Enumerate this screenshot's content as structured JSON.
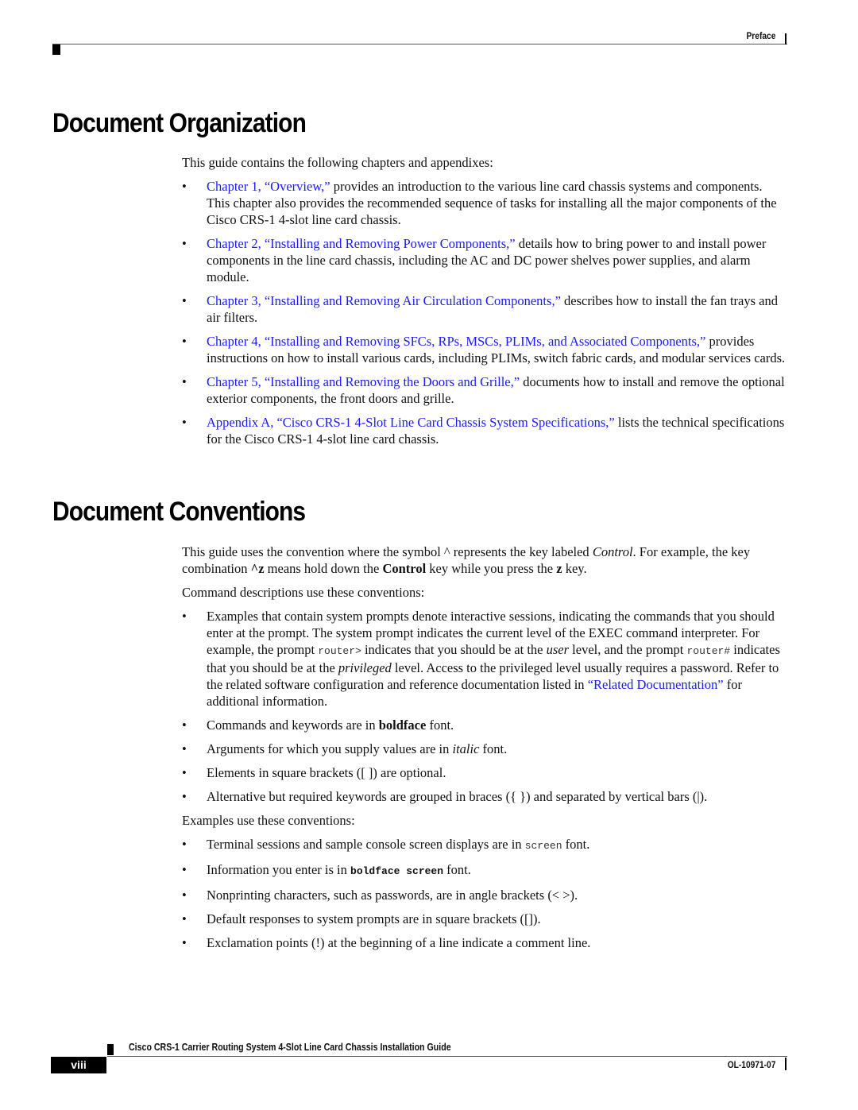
{
  "header": {
    "section": "Preface"
  },
  "organization": {
    "title": "Document Organization",
    "intro": "This guide contains the following chapters and appendixes:",
    "items": [
      {
        "link": "Chapter 1, “Overview,”",
        "text": " provides an introduction to the various line card chassis systems and components. This chapter also provides the recommended sequence of tasks for installing all the major components of the Cisco CRS-1 4-slot line card chassis."
      },
      {
        "link": "Chapter 2, “Installing and Removing Power Components,”",
        "text": " details how to bring power to and install power components in the line card chassis, including the AC and DC power shelves power supplies, and alarm module."
      },
      {
        "link": "Chapter 3, “Installing and Removing Air Circulation Components,”",
        "text": " describes how to install the fan trays and air filters."
      },
      {
        "link": "Chapter 4, “Installing and Removing SFCs, RPs, MSCs, PLIMs, and Associated Components,”",
        "text": " provides instructions on how to install various cards, including PLIMs, switch fabric cards, and modular services cards."
      },
      {
        "link": "Chapter 5, “Installing and Removing the Doors and Grille,”",
        "text": " documents how to install and remove the optional exterior components, the front doors and grille."
      },
      {
        "link": "Appendix A, “Cisco CRS-1 4-Slot Line Card Chassis System Specifications,”",
        "text": " lists the technical specifications for the Cisco CRS-1 4-slot line card chassis."
      }
    ]
  },
  "conventions": {
    "title": "Document Conventions",
    "p1": {
      "a": "This guide uses the convention where the symbol ^ represents the key labeled ",
      "control_italic": "Control",
      "b": ". For example, the key combination ",
      "caret_z": "^z",
      "c": " means hold down the ",
      "control_bold": "Control",
      "d": " key while you press the ",
      "z": "z",
      "e": " key."
    },
    "command_intro": "Command descriptions use these conventions:",
    "command_items": {
      "i0": {
        "a": "Examples that contain system prompts denote interactive sessions, indicating the commands that you should enter at the prompt. The system prompt indicates the current level of the EXEC command interpreter. For example, the prompt ",
        "prompt1": "router>",
        "b": " indicates that you should be at the ",
        "user": "user",
        "c": " level, and the prompt ",
        "prompt2": "router#",
        "d": " indicates that you should be at the ",
        "privileged": "privileged",
        "e": " level. Access to the privileged level usually requires a password. Refer to the related software configuration and reference documentation listed in ",
        "link": "“Related Documentation”",
        "f": " for additional information."
      },
      "i1": {
        "a": "Commands and keywords are in ",
        "bold": "boldface",
        "b": " font."
      },
      "i2": {
        "a": "Arguments for which you supply values are in ",
        "italic": "italic",
        "b": " font."
      },
      "i3": {
        "a": "Elements in square brackets ([ ]) are optional."
      },
      "i4": {
        "a": "Alternative but required keywords are grouped in braces ({ }) and separated by vertical bars (|)."
      }
    },
    "example_intro": "Examples use these conventions:",
    "example_items": {
      "i0": {
        "a": "Terminal sessions and sample console screen displays are in ",
        "mono": "screen",
        "b": " font."
      },
      "i1": {
        "a": "Information you enter is in ",
        "mono": "boldface screen",
        "b": " font."
      },
      "i2": {
        "a": "Nonprinting characters, such as passwords, are in angle brackets (< >)."
      },
      "i3": {
        "a": "Default responses to system prompts are in square brackets ([])."
      },
      "i4": {
        "a": "Exclamation points (!) at the beginning of a line indicate a comment line."
      }
    }
  },
  "footer": {
    "title": "Cisco CRS-1 Carrier Routing System 4-Slot Line Card Chassis Installation Guide",
    "page": "viii",
    "doc_number": "OL-10971-07"
  }
}
